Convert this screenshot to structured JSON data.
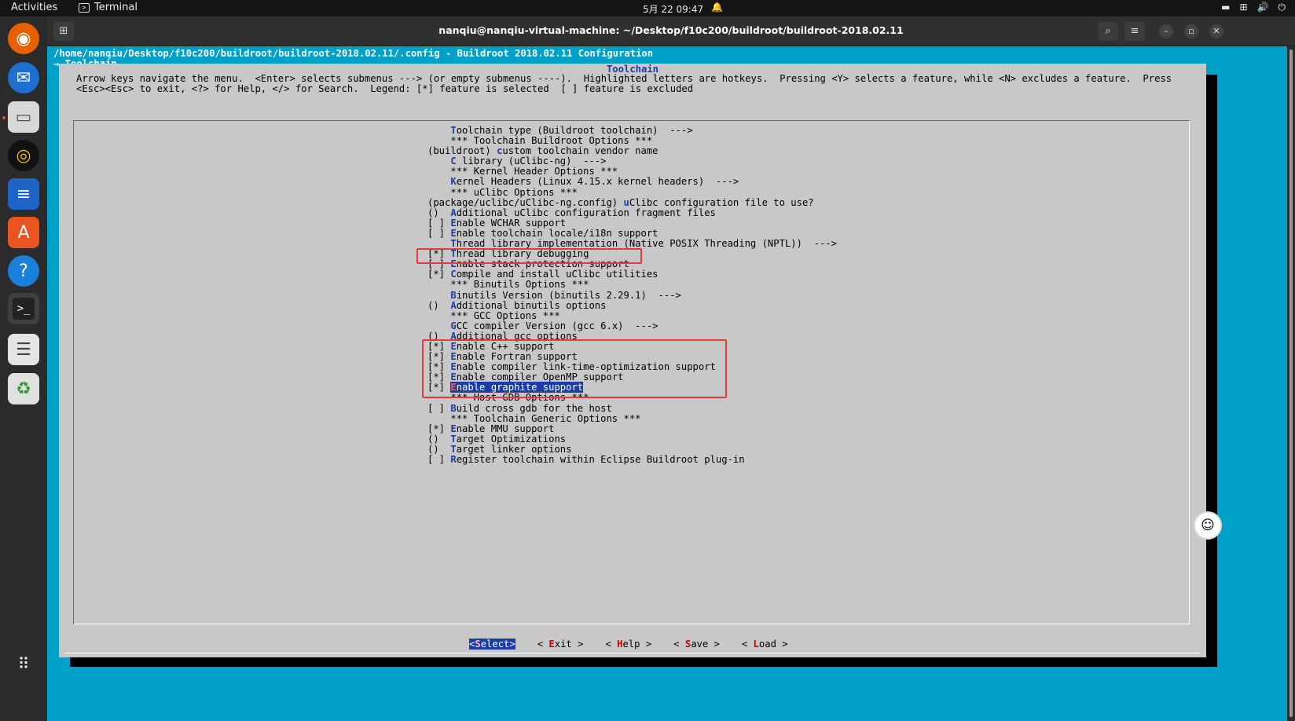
{
  "topbar": {
    "activities": "Activities",
    "app_name": "Terminal",
    "clock": "5月 22  09:47",
    "icons": [
      "notification-bell-icon",
      "keyboard-icon",
      "network-icon",
      "volume-icon",
      "power-icon"
    ]
  },
  "dock": {
    "apps": [
      "firefox-icon",
      "thunderbird-icon",
      "files-icon",
      "rhythmbox-icon",
      "libreoffice-writer-icon",
      "app-center-icon",
      "help-icon",
      "terminal-icon",
      "text-editor-icon",
      "trash-icon",
      "show-apps-icon"
    ]
  },
  "window": {
    "title": "nanqiu@nanqiu-virtual-machine: ~/Desktop/f10c200/buildroot/buildroot-2018.02.11",
    "buttons": [
      "search-icon",
      "menu-icon",
      "minimize-icon",
      "maximize-icon",
      "close-icon"
    ]
  },
  "menuconfig": {
    "config_path": "/home/nanqiu/Desktop/f10c200/buildroot/buildroot-2018.02.11/.config - Buildroot 2018.02.11 Configuration",
    "section_path": "→ Toolchain",
    "dialog_title": "Toolchain",
    "help_line1": "Arrow keys navigate the menu.  <Enter> selects submenus ---> (or empty submenus ----).  Highlighted letters are hotkeys.  Pressing <Y> selects a feature, while <N> excludes a feature.  Press",
    "help_line2": "<Esc><Esc> to exit, <?> for Help, </> for Search.  Legend: [*] feature is selected  [ ] feature is excluded",
    "items": [
      {
        "pre": "    ",
        "hk": "T",
        "rest": "oolchain type (Buildroot toolchain)  --->"
      },
      {
        "pre": "    ",
        "hk": "",
        "rest": "*** Toolchain Buildroot Options ***"
      },
      {
        "pre": "(buildroot) ",
        "hk": "c",
        "rest": "ustom toolchain vendor name"
      },
      {
        "pre": "    ",
        "hk": "C",
        "rest": " library (uClibc-ng)  --->"
      },
      {
        "pre": "    ",
        "hk": "",
        "rest": "*** Kernel Header Options ***"
      },
      {
        "pre": "    ",
        "hk": "K",
        "rest": "ernel Headers (Linux 4.15.x kernel headers)  --->"
      },
      {
        "pre": "    ",
        "hk": "",
        "rest": "*** uClibc Options ***"
      },
      {
        "pre": "(package/uclibc/uClibc-ng.config) ",
        "hk": "u",
        "rest": "Clibc configuration file to use?"
      },
      {
        "pre": "()  ",
        "hk": "A",
        "rest": "dditional uClibc configuration fragment files"
      },
      {
        "pre": "[ ] ",
        "hk": "E",
        "rest": "nable WCHAR support"
      },
      {
        "pre": "[ ] ",
        "hk": "E",
        "rest": "nable toolchain locale/i18n support"
      },
      {
        "pre": "    ",
        "hk": "T",
        "rest": "hread library implementation (Native POSIX Threading (NPTL))  --->"
      },
      {
        "pre": "[*] ",
        "hk": "T",
        "rest": "hread library debugging"
      },
      {
        "pre": "[ ] ",
        "hk": "E",
        "rest": "nable stack protection support"
      },
      {
        "pre": "[*] ",
        "hk": "C",
        "rest": "ompile and install uClibc utilities"
      },
      {
        "pre": "    ",
        "hk": "",
        "rest": "*** Binutils Options ***"
      },
      {
        "pre": "    ",
        "hk": "B",
        "rest": "inutils Version (binutils 2.29.1)  --->"
      },
      {
        "pre": "()  ",
        "hk": "A",
        "rest": "dditional binutils options"
      },
      {
        "pre": "    ",
        "hk": "",
        "rest": "*** GCC Options ***"
      },
      {
        "pre": "    ",
        "hk": "G",
        "rest": "CC compiler Version (gcc 6.x)  --->"
      },
      {
        "pre": "()  ",
        "hk": "A",
        "rest": "dditional gcc options"
      },
      {
        "pre": "[*] ",
        "hk": "E",
        "rest": "nable C++ support"
      },
      {
        "pre": "[*] ",
        "hk": "E",
        "rest": "nable Fortran support"
      },
      {
        "pre": "[*] ",
        "hk": "E",
        "rest": "nable compiler link-time-optimization support"
      },
      {
        "pre": "[*] ",
        "hk": "E",
        "rest": "nable compiler OpenMP support"
      },
      {
        "pre": "[*] ",
        "hk": "E",
        "rest": "nable graphite support",
        "selected": true
      },
      {
        "pre": "    ",
        "hk": "",
        "rest": "*** Host GDB Options ***"
      },
      {
        "pre": "[ ] ",
        "hk": "B",
        "rest": "uild cross gdb for the host"
      },
      {
        "pre": "    ",
        "hk": "",
        "rest": "*** Toolchain Generic Options ***"
      },
      {
        "pre": "[*] ",
        "hk": "E",
        "rest": "nable MMU support"
      },
      {
        "pre": "()  ",
        "hk": "T",
        "rest": "arget Optimizations"
      },
      {
        "pre": "()  ",
        "hk": "T",
        "rest": "arget linker options"
      },
      {
        "pre": "[ ] ",
        "hk": "R",
        "rest": "egister toolchain within Eclipse Buildroot plug-in"
      }
    ],
    "buttons": [
      {
        "pre": "<",
        "hk": "S",
        "rest": "elect>",
        "selected": true
      },
      {
        "pre": "< ",
        "hk": "E",
        "rest": "xit >"
      },
      {
        "pre": "< ",
        "hk": "H",
        "rest": "elp >"
      },
      {
        "pre": "< ",
        "hk": "S",
        "rest": "ave >"
      },
      {
        "pre": "< ",
        "hk": "L",
        "rest": "oad >"
      }
    ]
  },
  "colors": {
    "terminal_bg": "#00a0c8",
    "dialog_bg": "#c8c8c8",
    "hotkey": "#1a3ea8",
    "selection": "#1a3ea8",
    "annotation_box": "#e33c3c"
  }
}
